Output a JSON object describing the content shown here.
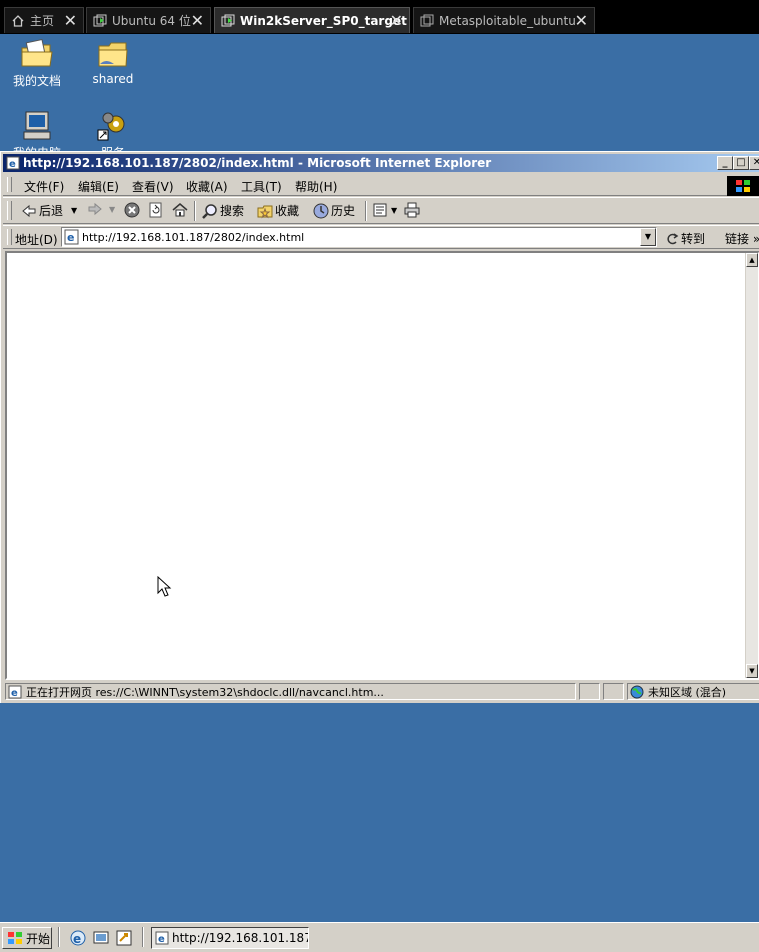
{
  "vm_tabs": [
    {
      "label": "主页",
      "icon": "home-icon",
      "active": false
    },
    {
      "label": "Ubuntu 64 位",
      "icon": "vm-icon",
      "active": false
    },
    {
      "label": "Win2kServer_SP0_target",
      "icon": "vm-icon",
      "active": true
    },
    {
      "label": "Metasploitable_ubuntu",
      "icon": "vm-icon",
      "active": false
    }
  ],
  "desktop_icons": [
    {
      "label": "我的文档",
      "icon": "my-documents-icon"
    },
    {
      "label": "shared",
      "icon": "folder-shortcut-icon"
    },
    {
      "label": "我的电脑",
      "icon": "my-computer-icon"
    },
    {
      "label": "服务",
      "icon": "services-shortcut-icon"
    }
  ],
  "ie_window": {
    "title": "http://192.168.101.187/2802/index.html - Microsoft Internet Explorer",
    "menu": [
      "文件(F)",
      "编辑(E)",
      "查看(V)",
      "收藏(A)",
      "工具(T)",
      "帮助(H)"
    ],
    "toolbar": {
      "back": "后退",
      "search": "搜索",
      "favorites": "收藏",
      "history": "历史"
    },
    "address_label": "地址(D)",
    "address_value": "http://192.168.101.187/2802/index.html",
    "go_label": "转到",
    "links_label": "链接 »",
    "status_text": "正在打开网页 res://C:\\WINNT\\system32\\shdoclc.dll/navcancl.htm...",
    "zone_text": "未知区域 (混合)"
  },
  "taskbar": {
    "start_label": "开始",
    "task_label": "http://192.168.101.187/..."
  },
  "colors": {
    "desktop": "#3a6ea5",
    "title_start": "#0a246a",
    "title_end": "#a6caf0",
    "face": "#d4d0c8"
  }
}
